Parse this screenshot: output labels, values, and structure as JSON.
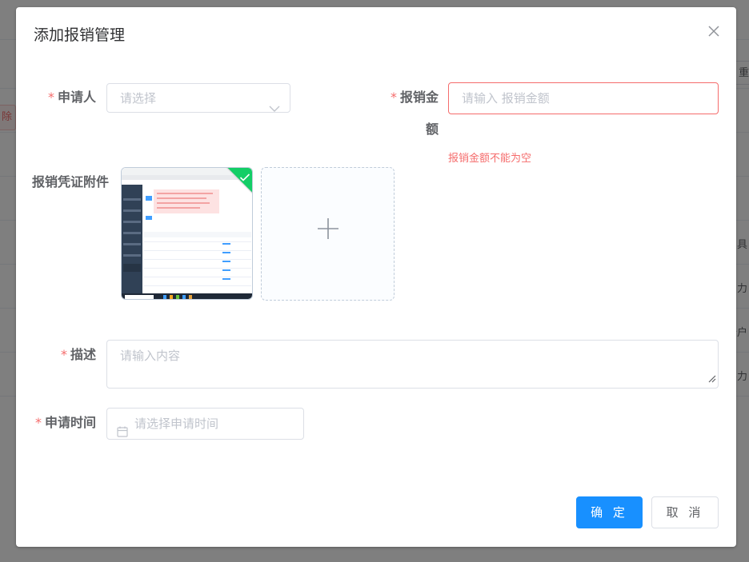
{
  "background": {
    "delete_fragment": "除",
    "reset_fragment": "重",
    "cell_fragments": [
      "具",
      "力",
      "卡户",
      "买力"
    ]
  },
  "dialog": {
    "title": "添加报销管理",
    "close_icon": "close-icon"
  },
  "form": {
    "required_mark": "*",
    "applicant": {
      "label": "申请人",
      "placeholder": "请选择",
      "icon": "chevron-down-icon"
    },
    "amount": {
      "label_line1": "报销金",
      "label_line2": "额",
      "placeholder": "请输入 报销金额",
      "error": "报销金额不能为空"
    },
    "attachment": {
      "label": "报销凭证附件",
      "uploaded_status_icon": "check-icon",
      "add_icon": "plus-icon"
    },
    "description": {
      "label": "描述",
      "placeholder": "请输入内容"
    },
    "apply_time": {
      "label": "申请时间",
      "placeholder": "请选择申请时间",
      "icon": "calendar-icon"
    }
  },
  "footer": {
    "confirm": "确 定",
    "cancel": "取 消"
  },
  "colors": {
    "primary": "#1890ff",
    "error": "#f56c6c",
    "success": "#13ce66"
  }
}
